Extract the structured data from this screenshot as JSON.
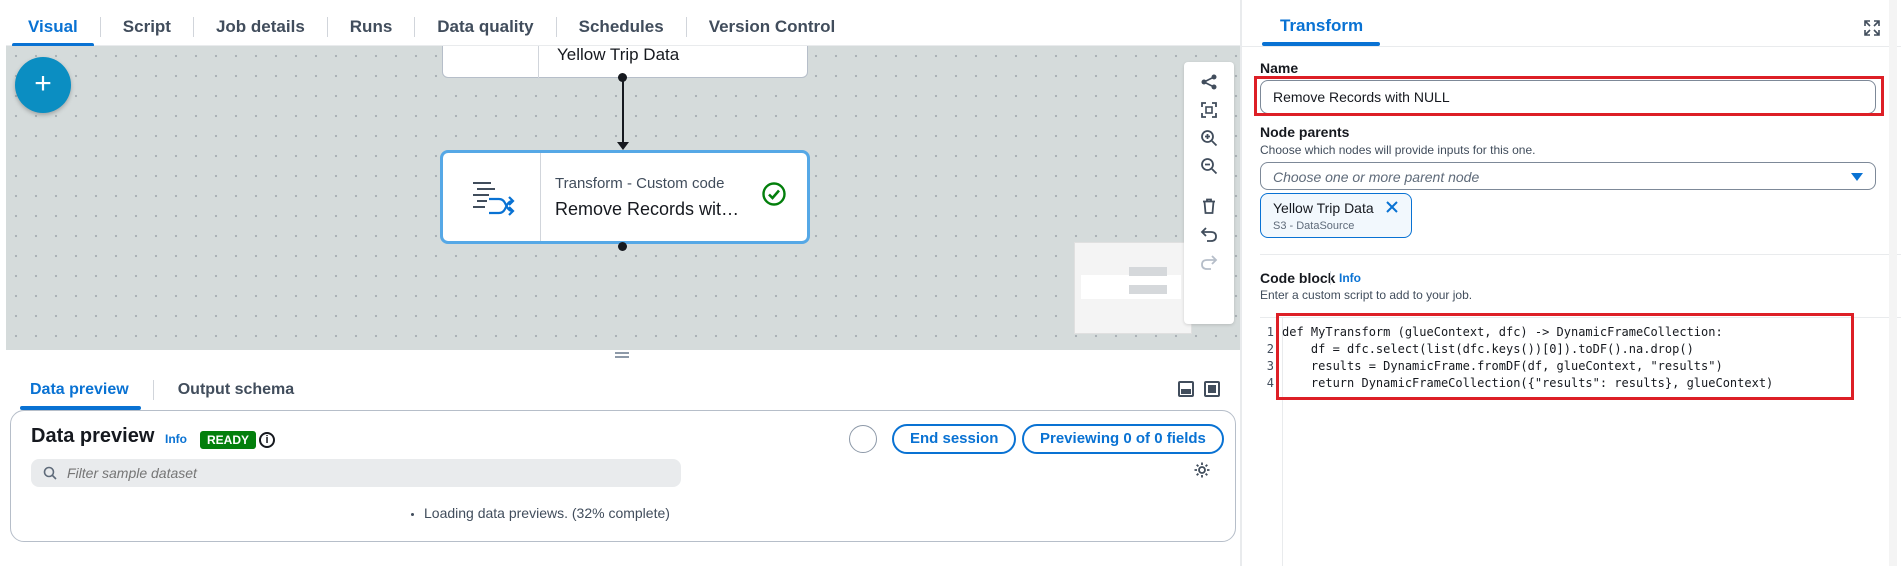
{
  "tabs": [
    {
      "label": "Visual",
      "active": true
    },
    {
      "label": "Script"
    },
    {
      "label": "Job details"
    },
    {
      "label": "Runs"
    },
    {
      "label": "Data quality"
    },
    {
      "label": "Schedules"
    },
    {
      "label": "Version Control"
    }
  ],
  "canvas": {
    "add_icon": "+",
    "source_node": {
      "label": "Yellow Trip Data"
    },
    "transform_node": {
      "type_label": "Transform - Custom code",
      "name": "Remove Records wit…",
      "status": "success"
    },
    "toolbar_icons": [
      "layout-icon",
      "fit-view-icon",
      "zoom-in-icon",
      "zoom-out-icon",
      "delete-icon",
      "undo-icon",
      "redo-icon"
    ]
  },
  "bottom": {
    "tabs": [
      {
        "label": "Data preview",
        "active": true
      },
      {
        "label": "Output schema"
      }
    ],
    "preview": {
      "title": "Data preview",
      "info": "Info",
      "badge": "READY",
      "end_session": "End session",
      "previewing": "Previewing 0 of 0 fields",
      "filter_placeholder": "Filter sample dataset",
      "loading": "Loading data previews. (32% complete)"
    }
  },
  "right": {
    "tab": "Transform",
    "name_label": "Name",
    "name_value": "Remove Records with NULL",
    "parents_label": "Node parents",
    "parents_desc": "Choose which nodes will provide inputs for this one.",
    "parents_placeholder": "Choose one or more parent node",
    "parent_token": {
      "name": "Yellow Trip Data",
      "sub": "S3 - DataSource"
    },
    "code_label": "Code block",
    "code_info": "Info",
    "code_desc": "Enter a custom script to add to your job.",
    "code_lines": [
      {
        "num": "1",
        "text": "def MyTransform (glueContext, dfc) -> DynamicFrameCollection:"
      },
      {
        "num": "2",
        "text": "    df = dfc.select(list(dfc.keys())[0]).toDF().na.drop()"
      },
      {
        "num": "3",
        "text": "    results = DynamicFrame.fromDF(df, glueContext, \"results\")"
      },
      {
        "num": "4",
        "text": "    return DynamicFrameCollection({\"results\": results}, glueContext)"
      }
    ]
  },
  "colors": {
    "accent": "#0972d3",
    "success": "#037f0c",
    "highlight": "#dd1f26",
    "fab": "#0b8ec2"
  }
}
